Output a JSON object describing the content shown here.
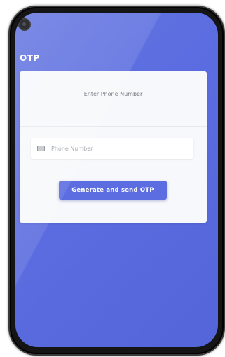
{
  "app": {
    "title": "OTP"
  },
  "card": {
    "title": "Enter Phone Number"
  },
  "phone_input": {
    "placeholder": "Phone Number",
    "value": "",
    "icon": "barcode-icon"
  },
  "actions": {
    "generate_label": "Generate and send OTP"
  },
  "colors": {
    "primary": "#5b6de0",
    "card_background": "#f7f8fb",
    "device_frame": "#151515"
  }
}
